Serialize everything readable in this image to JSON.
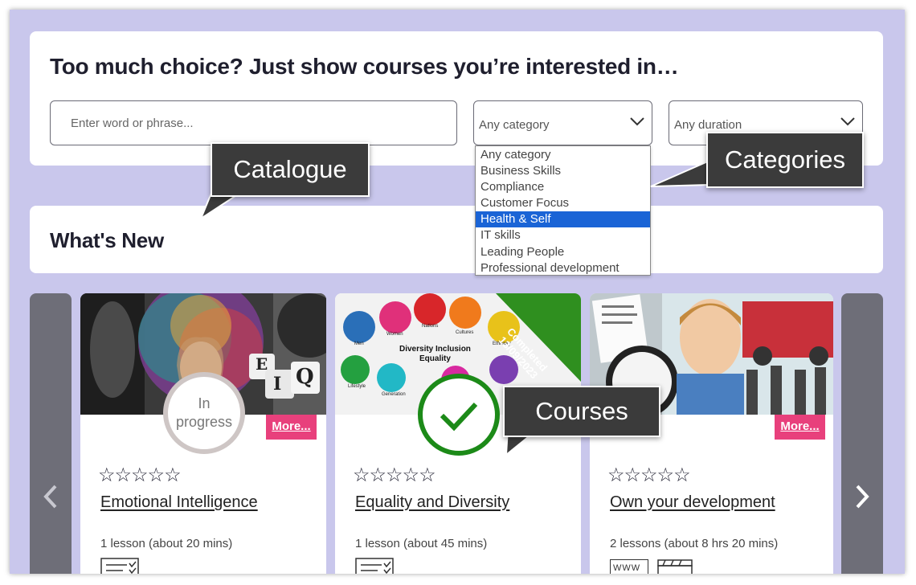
{
  "filter": {
    "title": "Too much choice? Just show courses you’re interested in…",
    "search_placeholder": "Enter word or phrase...",
    "category_value": "Any category",
    "duration_value": "Any duration",
    "category_options": [
      "Any category",
      "Business Skills",
      "Compliance",
      "Customer Focus",
      "Health & Self",
      "IT skills",
      "Leading People",
      "Professional development"
    ],
    "category_selected_index": 4
  },
  "whats_new": {
    "title": "What's New"
  },
  "callouts": {
    "catalogue": "Catalogue",
    "categories": "Categories",
    "courses": "Courses"
  },
  "courses": [
    {
      "title": "Emotional Intelligence",
      "meta": "1 lesson (about 20 mins)",
      "status_line1": "In",
      "status_line2": "progress",
      "more": "More...",
      "rating": "☆☆☆☆☆",
      "thumb_text": [
        "E",
        "I",
        "Q"
      ]
    },
    {
      "title": "Equality and Diversity",
      "meta": "1 lesson (about 45 mins)",
      "ribbon_line1": "Completed",
      "ribbon_line2": "13/09/2023",
      "rating": "☆☆☆☆☆",
      "thumb_heading1": "Diversity Inclusion",
      "thumb_heading2": "Equality",
      "thumb_labels": [
        "Men",
        "Women",
        "Nations",
        "Cultures",
        "Ethnicity",
        "Lifestyle",
        "Generation"
      ]
    },
    {
      "title": "Own your development",
      "meta": "2 lessons (about 8 hrs 20 mins)",
      "more": "More...",
      "rating": "☆☆☆☆☆",
      "thumb_text": [
        "WWW"
      ]
    }
  ],
  "colors": {
    "page_bg": "#c9c7ec",
    "accent_pink": "#e8407c",
    "complete_green": "#1c8a18",
    "selected_blue": "#1a64d6",
    "callout_bg": "#3b3b3b"
  }
}
